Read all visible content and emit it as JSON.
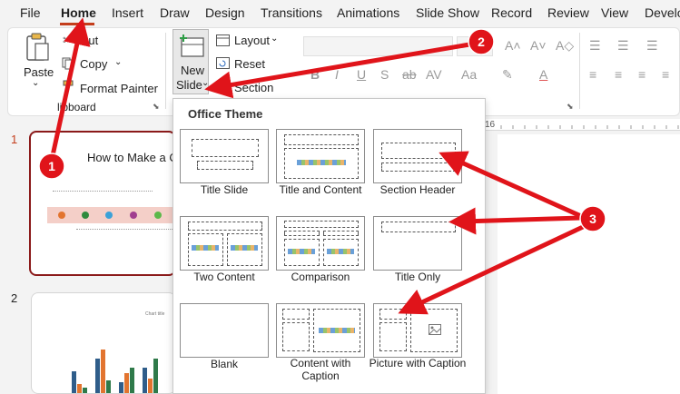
{
  "menu": {
    "items": [
      "File",
      "Home",
      "Insert",
      "Draw",
      "Design",
      "Transitions",
      "Animations",
      "Slide Show",
      "Record",
      "Review",
      "View",
      "Develo"
    ],
    "active": "Home"
  },
  "ribbon": {
    "paste_label": "Paste",
    "cut_label": "Cut",
    "copy_label": "Copy",
    "format_painter_label": "Format Painter",
    "clipboard_group": "lipboard",
    "new_slide_line1": "New",
    "new_slide_line2": "Slide",
    "layout_label": "Layout",
    "reset_label": "Reset",
    "section_label": "Section"
  },
  "dropdown": {
    "title": "Office Theme",
    "layouts": [
      {
        "label": "Title Slide"
      },
      {
        "label": "Title and Content"
      },
      {
        "label": "Section Header"
      },
      {
        "label": "Two Content"
      },
      {
        "label": "Comparison"
      },
      {
        "label": "Title Only"
      },
      {
        "label": "Blank"
      },
      {
        "label": "Content with Caption"
      },
      {
        "label": "Picture with Caption"
      }
    ]
  },
  "thumbnails": [
    {
      "number": "1",
      "title": "How to Make a C"
    },
    {
      "number": "2",
      "title": "Chart title"
    }
  ],
  "ruler": {
    "mark": "16"
  },
  "annotations": {
    "badges": [
      "1",
      "2",
      "3"
    ],
    "color": "#e0141a"
  }
}
